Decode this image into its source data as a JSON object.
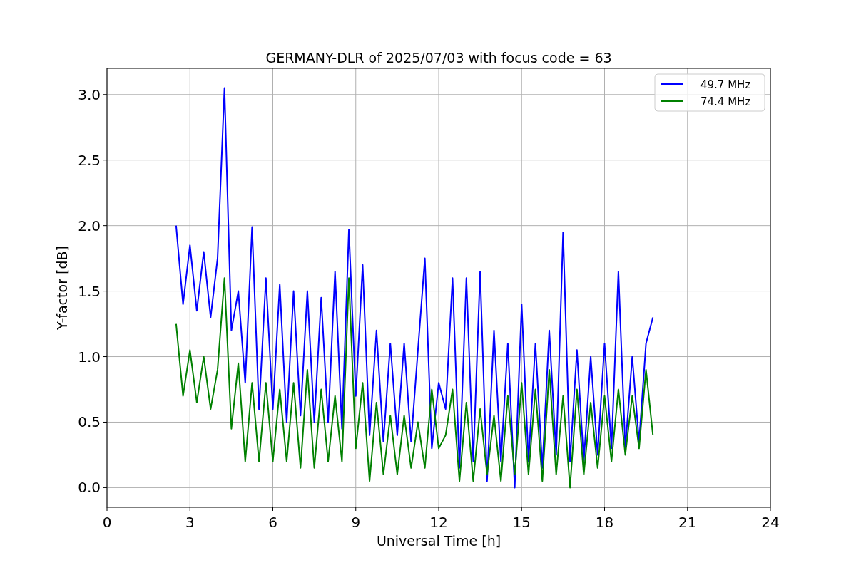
{
  "chart_data": {
    "type": "line",
    "title": "GERMANY-DLR of 2025/07/03 with focus code = 63",
    "xlabel": "Universal Time [h]",
    "ylabel": "Y-factor [dB]",
    "grid": true,
    "legend": "upper right",
    "xlim": [
      0,
      24
    ],
    "ylim": [
      -0.15,
      3.2
    ],
    "xticks": [
      0,
      3,
      6,
      9,
      12,
      15,
      18,
      21,
      24
    ],
    "yticks": [
      {
        "value": 0,
        "label": "0.0"
      },
      {
        "value": 0.5,
        "label": "0.5"
      },
      {
        "value": 1,
        "label": "1.0"
      },
      {
        "value": 1.5,
        "label": "1.5"
      },
      {
        "value": 2,
        "label": "2.0"
      },
      {
        "value": 2.5,
        "label": "2.5"
      },
      {
        "value": 3,
        "label": "3.0"
      }
    ],
    "x": [
      2.5,
      2.75,
      3,
      3.25,
      3.5,
      3.75,
      4,
      4.25,
      4.5,
      4.75,
      5,
      5.25,
      5.5,
      5.75,
      6,
      6.25,
      6.5,
      6.75,
      7,
      7.25,
      7.5,
      7.75,
      8,
      8.25,
      8.5,
      8.75,
      9,
      9.25,
      9.5,
      9.75,
      10,
      10.25,
      10.5,
      10.75,
      11,
      11.25,
      11.5,
      11.75,
      12,
      12.25,
      12.5,
      12.75,
      13,
      13.25,
      13.5,
      13.75,
      14,
      14.25,
      14.5,
      14.75,
      15,
      15.25,
      15.5,
      15.75,
      16,
      16.25,
      16.5,
      16.75,
      17,
      17.25,
      17.5,
      17.75,
      18,
      18.25,
      18.5,
      18.75,
      19,
      19.25,
      19.5,
      19.75
    ],
    "series": [
      {
        "name": "49.7 MHz",
        "color": "#0000ff",
        "values": [
          2.0,
          1.4,
          1.85,
          1.35,
          1.8,
          1.3,
          1.75,
          3.05,
          1.2,
          1.5,
          0.8,
          1.99,
          0.6,
          1.6,
          0.6,
          1.55,
          0.5,
          1.5,
          0.55,
          1.5,
          0.5,
          1.45,
          0.5,
          1.65,
          0.45,
          1.97,
          0.7,
          1.7,
          0.4,
          1.2,
          0.35,
          1.1,
          0.4,
          1.1,
          0.35,
          1.05,
          1.75,
          0.3,
          0.8,
          0.6,
          1.6,
          0.15,
          1.6,
          0.2,
          1.65,
          0.05,
          1.2,
          0.2,
          1.1,
          0.0,
          1.4,
          0.2,
          1.1,
          0.15,
          1.2,
          0.25,
          1.95,
          0.2,
          1.05,
          0.2,
          1.0,
          0.25,
          1.1,
          0.3,
          1.65,
          0.3,
          1.0,
          0.35,
          1.1,
          1.3
        ]
      },
      {
        "name": "74.4 MHz",
        "color": "#008000",
        "values": [
          1.25,
          0.7,
          1.05,
          0.65,
          1.0,
          0.6,
          0.9,
          1.6,
          0.45,
          0.95,
          0.2,
          0.8,
          0.2,
          0.8,
          0.2,
          0.75,
          0.2,
          0.8,
          0.15,
          0.9,
          0.15,
          0.75,
          0.2,
          0.7,
          0.2,
          1.6,
          0.3,
          0.8,
          0.05,
          0.65,
          0.1,
          0.55,
          0.1,
          0.55,
          0.15,
          0.5,
          0.15,
          0.75,
          0.3,
          0.4,
          0.75,
          0.05,
          0.65,
          0.05,
          0.6,
          0.1,
          0.55,
          0.05,
          0.7,
          0.1,
          0.8,
          0.1,
          0.75,
          0.05,
          0.9,
          0.1,
          0.7,
          0.0,
          0.75,
          0.1,
          0.65,
          0.15,
          0.7,
          0.2,
          0.75,
          0.25,
          0.7,
          0.3,
          0.9,
          0.4
        ]
      }
    ]
  }
}
